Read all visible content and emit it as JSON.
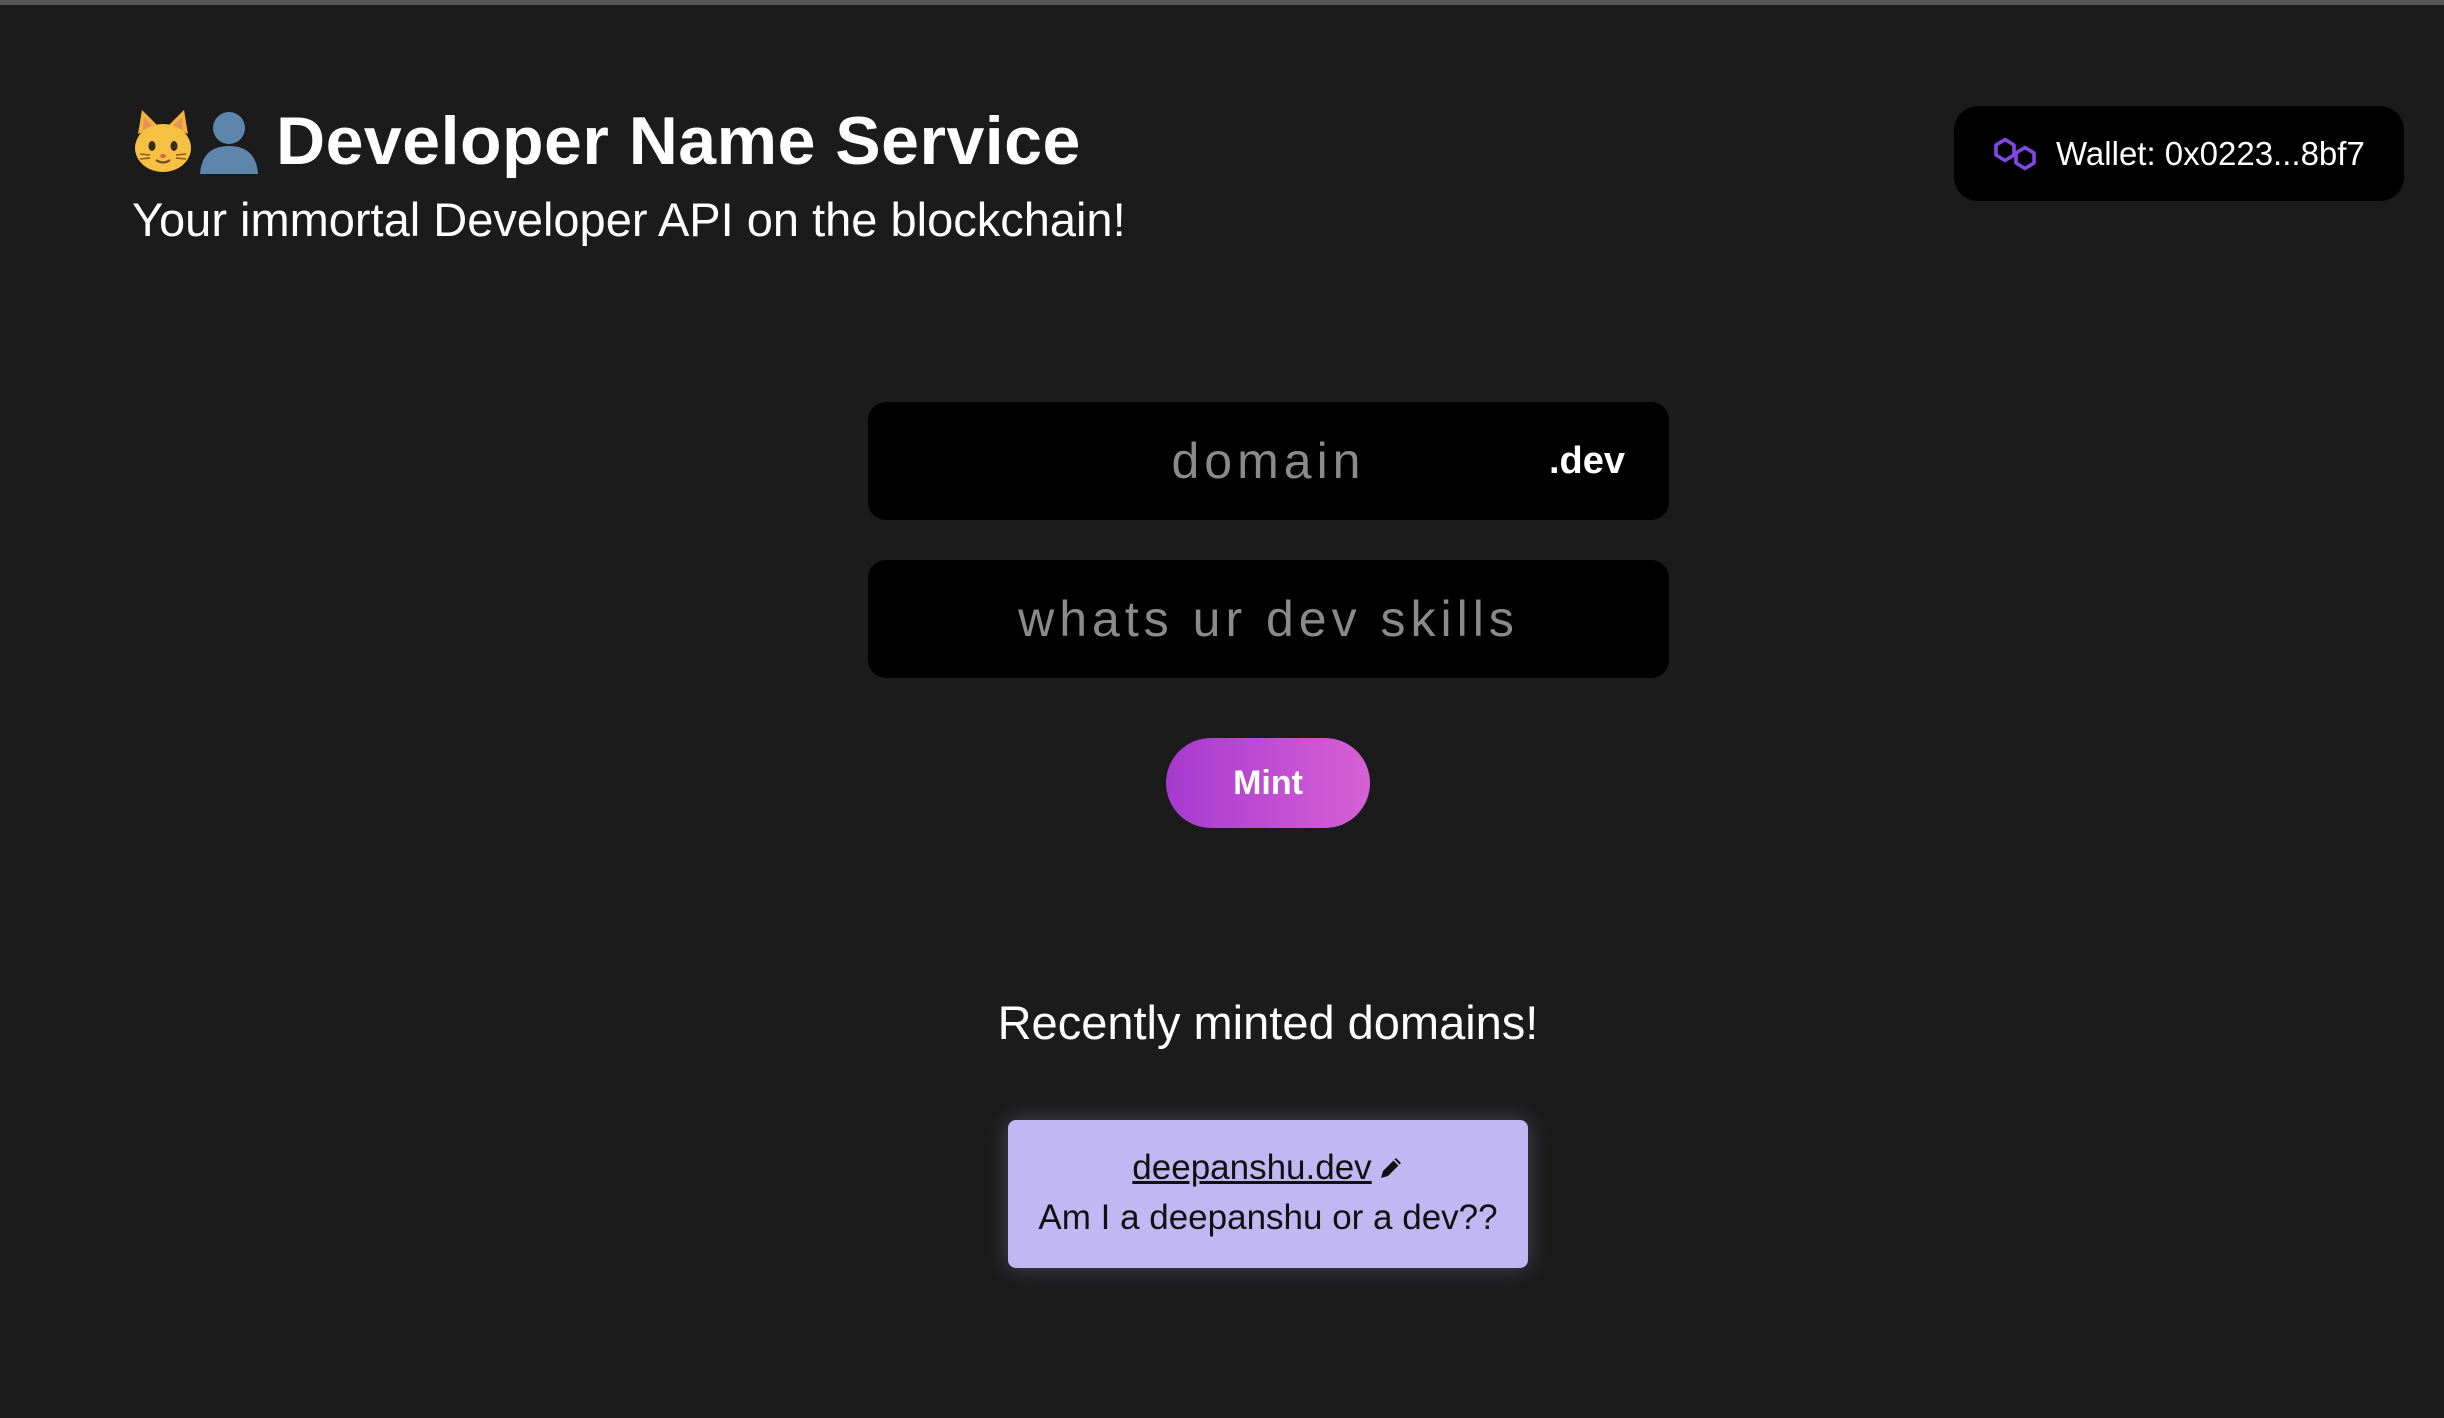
{
  "header": {
    "title": "Developer Name Service",
    "subtitle": "Your immortal Developer API on the blockchain!",
    "title_icons": [
      "cat-face-icon",
      "user-silhouette-icon"
    ]
  },
  "wallet": {
    "icon": "polygon-icon",
    "label": "Wallet: 0x0223...8bf7",
    "icon_color": "#8247e5"
  },
  "form": {
    "domain_placeholder": "domain",
    "domain_value": "",
    "tld": ".dev",
    "skills_placeholder": "whats ur dev skills",
    "skills_value": "",
    "mint_label": "Mint"
  },
  "recent": {
    "title": "Recently minted domains!",
    "items": [
      {
        "domain": "deepanshu.dev",
        "description": "Am I a deepanshu or a dev??",
        "edit_icon": "pencil-icon"
      }
    ]
  },
  "colors": {
    "background": "#1b1b1b",
    "field_background": "#000000",
    "mint_gradient_start": "#a63acf",
    "mint_gradient_end": "#d760d4",
    "card_background": "#c1b7f3"
  }
}
